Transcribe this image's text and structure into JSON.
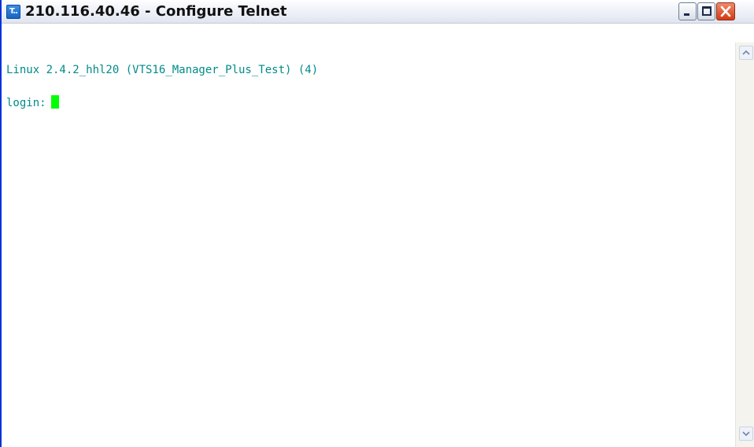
{
  "window": {
    "title": "210.116.40.46 - Configure Telnet",
    "app_icon_label": "T..",
    "icon": "telnet-app-icon"
  },
  "title_buttons": {
    "minimize_icon": "minimize-icon",
    "maximize_icon": "maximize-icon",
    "close_icon": "close-icon"
  },
  "terminal": {
    "lines": [
      "Linux 2.4.2_hhl20 (VTS16_Manager_Plus_Test) (4)",
      "login:"
    ],
    "text_color": "#008b8b",
    "cursor_color": "#00ff00",
    "background": "#ffffff"
  },
  "scrollbar": {
    "up_icon": "scroll-up-arrow-icon",
    "down_icon": "scroll-down-arrow-icon"
  },
  "colors": {
    "window_border": "#0831d9",
    "close_button": "#d33b14"
  }
}
